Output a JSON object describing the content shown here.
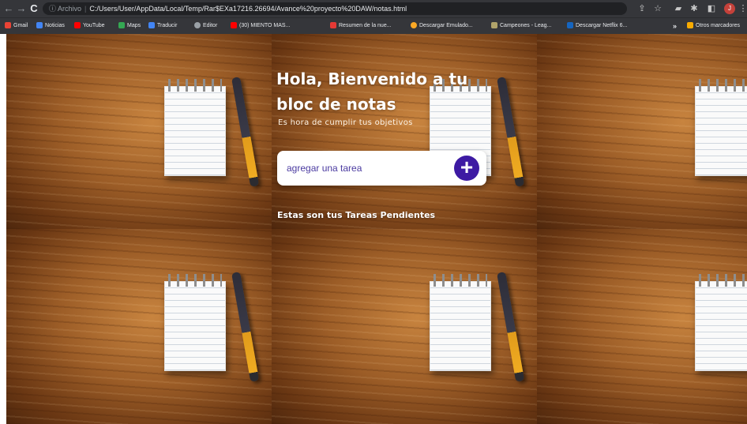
{
  "browser": {
    "nav": {
      "back": "←",
      "forward": "→",
      "reload": "C"
    },
    "address": {
      "security_label": "ⓘ Archivo",
      "separator": "|",
      "url": "C:/Users/User/AppData/Local/Temp/Rar$EXa17216.26694/Avance%20proyecto%20DAW/notas.html"
    },
    "toolbar": {
      "share": "⇪",
      "star": "☆",
      "pin": "▰",
      "extensions": "✱",
      "sidepanel": "◧",
      "profile": "J",
      "menu": "⋮"
    }
  },
  "bookmarks": [
    {
      "label": "Gmail",
      "color": "#ea4335"
    },
    {
      "label": "Noticias",
      "color": "#4285f4"
    },
    {
      "label": "YouTube",
      "color": "#ff0000"
    },
    {
      "label": "Maps",
      "color": "#34a853"
    },
    {
      "label": "Traducir",
      "color": "#4285f4"
    },
    {
      "label": "Editor",
      "color": "#9aa0a6"
    },
    {
      "label": "(30) MIENTO MAS...",
      "color": "#ff0000"
    },
    {
      "label": "Resumen de la nue...",
      "color": "#e53935"
    },
    {
      "label": "Descargar Emulado...",
      "color": "#f9a825"
    },
    {
      "label": "Campeones - Leag...",
      "color": "#b0a36a"
    },
    {
      "label": "Descargar Netflix 6...",
      "color": "#1565c0"
    }
  ],
  "bookmarks_more": "»",
  "other_bookmarks": {
    "label": "Otros marcadores",
    "color": "#f9ab00"
  },
  "page": {
    "title": "Hola, Bienvenido a tu bloc de notas",
    "subtitle": "Es hora de cumplir tus objetivos",
    "task_placeholder": "agregar una tarea",
    "add_icon_glyph": "+",
    "pending_heading": "Estas son tus Tareas Pendientes"
  }
}
